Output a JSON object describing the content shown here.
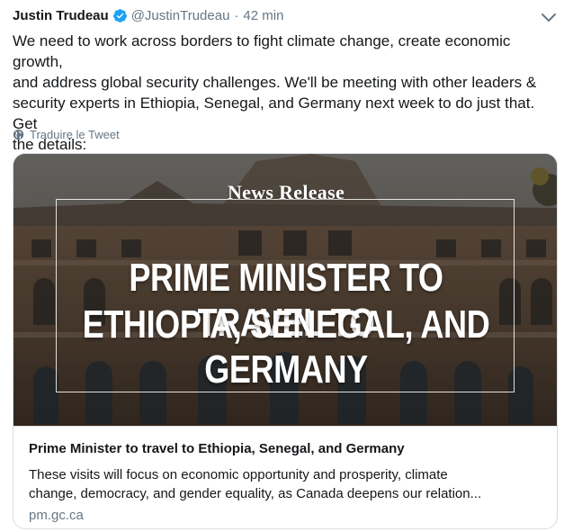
{
  "tweet": {
    "author_name": "Justin Trudeau",
    "author_handle": "@JustinTrudeau",
    "separator": "·",
    "timestamp": "42 min",
    "text_lines": [
      "We need to work across borders to fight climate change, create economic growth,",
      "and address global security challenges. We'll be meeting with other leaders &",
      "security experts in Ethiopia, Senegal, and Germany next week to do just that. Get",
      "the details:"
    ],
    "translate_label": "Traduire le Tweet"
  },
  "card": {
    "image_banner": "News Release",
    "image_headline_line1": "PRIME MINISTER TO TRAVEL TO",
    "image_headline_line2": "ETHIOPIA, SENEGAL, AND GERMANY",
    "title": "Prime Minister to travel to Ethiopia, Senegal, and Germany",
    "description_lines": [
      "These visits will focus on economic opportunity and prosperity, climate",
      "change, democracy, and gender equality, as Canada deepens our relation..."
    ],
    "domain": "pm.gc.ca"
  },
  "icons": {
    "verified": "verified-badge-icon",
    "caret": "chevron-down-icon",
    "translate": "globe-icon"
  },
  "colors": {
    "verified_blue": "#1da1f2",
    "secondary_text": "#657786",
    "border": "#d7dde2"
  }
}
